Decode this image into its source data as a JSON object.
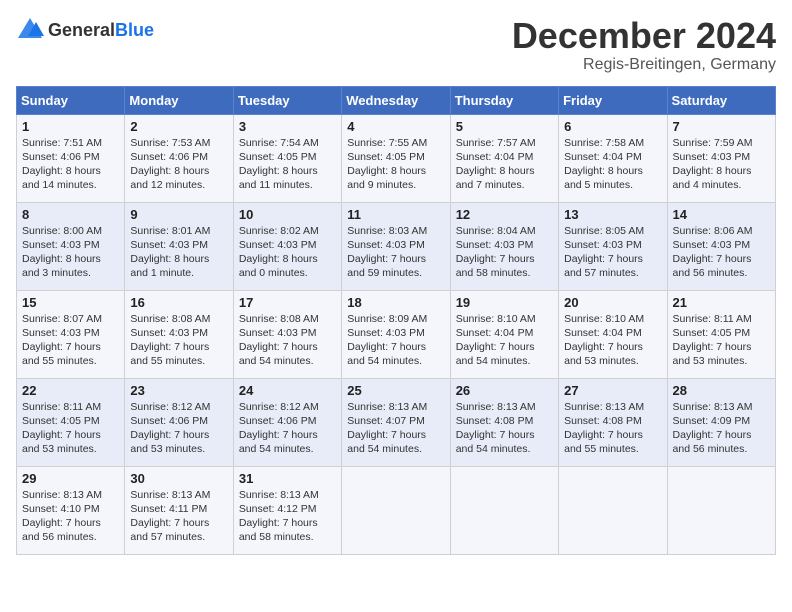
{
  "header": {
    "logo_general": "General",
    "logo_blue": "Blue",
    "title": "December 2024",
    "subtitle": "Regis-Breitingen, Germany"
  },
  "columns": [
    "Sunday",
    "Monday",
    "Tuesday",
    "Wednesday",
    "Thursday",
    "Friday",
    "Saturday"
  ],
  "weeks": [
    [
      {
        "day": "1",
        "lines": [
          "Sunrise: 7:51 AM",
          "Sunset: 4:06 PM",
          "Daylight: 8 hours",
          "and 14 minutes."
        ]
      },
      {
        "day": "2",
        "lines": [
          "Sunrise: 7:53 AM",
          "Sunset: 4:06 PM",
          "Daylight: 8 hours",
          "and 12 minutes."
        ]
      },
      {
        "day": "3",
        "lines": [
          "Sunrise: 7:54 AM",
          "Sunset: 4:05 PM",
          "Daylight: 8 hours",
          "and 11 minutes."
        ]
      },
      {
        "day": "4",
        "lines": [
          "Sunrise: 7:55 AM",
          "Sunset: 4:05 PM",
          "Daylight: 8 hours",
          "and 9 minutes."
        ]
      },
      {
        "day": "5",
        "lines": [
          "Sunrise: 7:57 AM",
          "Sunset: 4:04 PM",
          "Daylight: 8 hours",
          "and 7 minutes."
        ]
      },
      {
        "day": "6",
        "lines": [
          "Sunrise: 7:58 AM",
          "Sunset: 4:04 PM",
          "Daylight: 8 hours",
          "and 5 minutes."
        ]
      },
      {
        "day": "7",
        "lines": [
          "Sunrise: 7:59 AM",
          "Sunset: 4:03 PM",
          "Daylight: 8 hours",
          "and 4 minutes."
        ]
      }
    ],
    [
      {
        "day": "8",
        "lines": [
          "Sunrise: 8:00 AM",
          "Sunset: 4:03 PM",
          "Daylight: 8 hours",
          "and 3 minutes."
        ]
      },
      {
        "day": "9",
        "lines": [
          "Sunrise: 8:01 AM",
          "Sunset: 4:03 PM",
          "Daylight: 8 hours",
          "and 1 minute."
        ]
      },
      {
        "day": "10",
        "lines": [
          "Sunrise: 8:02 AM",
          "Sunset: 4:03 PM",
          "Daylight: 8 hours",
          "and 0 minutes."
        ]
      },
      {
        "day": "11",
        "lines": [
          "Sunrise: 8:03 AM",
          "Sunset: 4:03 PM",
          "Daylight: 7 hours",
          "and 59 minutes."
        ]
      },
      {
        "day": "12",
        "lines": [
          "Sunrise: 8:04 AM",
          "Sunset: 4:03 PM",
          "Daylight: 7 hours",
          "and 58 minutes."
        ]
      },
      {
        "day": "13",
        "lines": [
          "Sunrise: 8:05 AM",
          "Sunset: 4:03 PM",
          "Daylight: 7 hours",
          "and 57 minutes."
        ]
      },
      {
        "day": "14",
        "lines": [
          "Sunrise: 8:06 AM",
          "Sunset: 4:03 PM",
          "Daylight: 7 hours",
          "and 56 minutes."
        ]
      }
    ],
    [
      {
        "day": "15",
        "lines": [
          "Sunrise: 8:07 AM",
          "Sunset: 4:03 PM",
          "Daylight: 7 hours",
          "and 55 minutes."
        ]
      },
      {
        "day": "16",
        "lines": [
          "Sunrise: 8:08 AM",
          "Sunset: 4:03 PM",
          "Daylight: 7 hours",
          "and 55 minutes."
        ]
      },
      {
        "day": "17",
        "lines": [
          "Sunrise: 8:08 AM",
          "Sunset: 4:03 PM",
          "Daylight: 7 hours",
          "and 54 minutes."
        ]
      },
      {
        "day": "18",
        "lines": [
          "Sunrise: 8:09 AM",
          "Sunset: 4:03 PM",
          "Daylight: 7 hours",
          "and 54 minutes."
        ]
      },
      {
        "day": "19",
        "lines": [
          "Sunrise: 8:10 AM",
          "Sunset: 4:04 PM",
          "Daylight: 7 hours",
          "and 54 minutes."
        ]
      },
      {
        "day": "20",
        "lines": [
          "Sunrise: 8:10 AM",
          "Sunset: 4:04 PM",
          "Daylight: 7 hours",
          "and 53 minutes."
        ]
      },
      {
        "day": "21",
        "lines": [
          "Sunrise: 8:11 AM",
          "Sunset: 4:05 PM",
          "Daylight: 7 hours",
          "and 53 minutes."
        ]
      }
    ],
    [
      {
        "day": "22",
        "lines": [
          "Sunrise: 8:11 AM",
          "Sunset: 4:05 PM",
          "Daylight: 7 hours",
          "and 53 minutes."
        ]
      },
      {
        "day": "23",
        "lines": [
          "Sunrise: 8:12 AM",
          "Sunset: 4:06 PM",
          "Daylight: 7 hours",
          "and 53 minutes."
        ]
      },
      {
        "day": "24",
        "lines": [
          "Sunrise: 8:12 AM",
          "Sunset: 4:06 PM",
          "Daylight: 7 hours",
          "and 54 minutes."
        ]
      },
      {
        "day": "25",
        "lines": [
          "Sunrise: 8:13 AM",
          "Sunset: 4:07 PM",
          "Daylight: 7 hours",
          "and 54 minutes."
        ]
      },
      {
        "day": "26",
        "lines": [
          "Sunrise: 8:13 AM",
          "Sunset: 4:08 PM",
          "Daylight: 7 hours",
          "and 54 minutes."
        ]
      },
      {
        "day": "27",
        "lines": [
          "Sunrise: 8:13 AM",
          "Sunset: 4:08 PM",
          "Daylight: 7 hours",
          "and 55 minutes."
        ]
      },
      {
        "day": "28",
        "lines": [
          "Sunrise: 8:13 AM",
          "Sunset: 4:09 PM",
          "Daylight: 7 hours",
          "and 56 minutes."
        ]
      }
    ],
    [
      {
        "day": "29",
        "lines": [
          "Sunrise: 8:13 AM",
          "Sunset: 4:10 PM",
          "Daylight: 7 hours",
          "and 56 minutes."
        ]
      },
      {
        "day": "30",
        "lines": [
          "Sunrise: 8:13 AM",
          "Sunset: 4:11 PM",
          "Daylight: 7 hours",
          "and 57 minutes."
        ]
      },
      {
        "day": "31",
        "lines": [
          "Sunrise: 8:13 AM",
          "Sunset: 4:12 PM",
          "Daylight: 7 hours",
          "and 58 minutes."
        ]
      },
      null,
      null,
      null,
      null
    ]
  ]
}
